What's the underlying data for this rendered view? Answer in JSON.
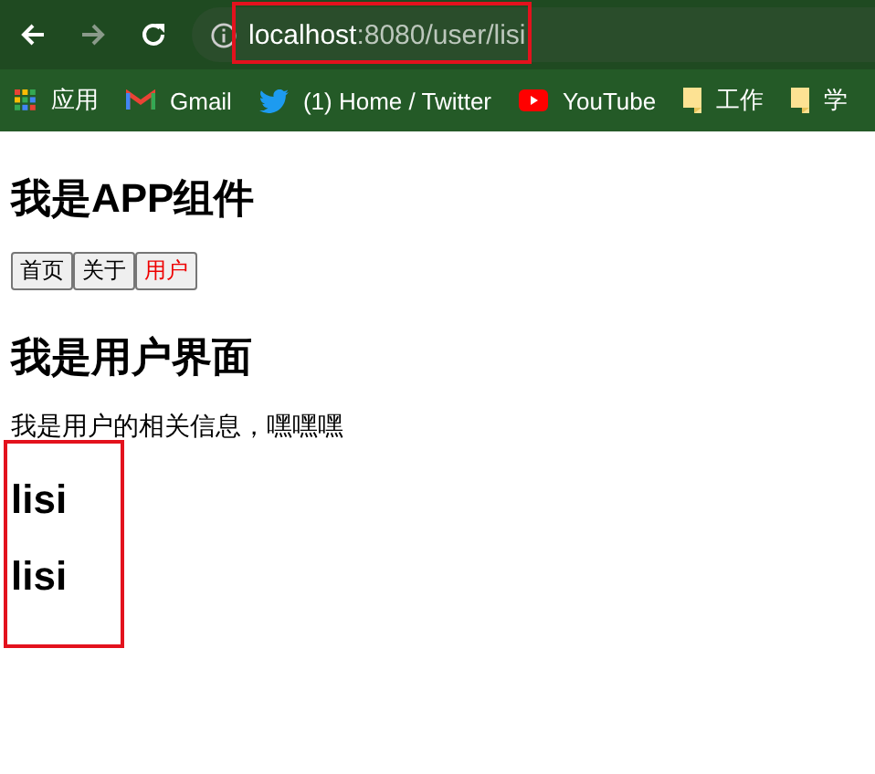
{
  "browser": {
    "url_host": "localhost",
    "url_path": ":8080/user/lisi",
    "bookmarks": [
      {
        "kind": "apps",
        "label": "应用"
      },
      {
        "kind": "gmail",
        "label": "Gmail"
      },
      {
        "kind": "twitter",
        "label": "(1) Home / Twitter"
      },
      {
        "kind": "youtube",
        "label": "YouTube"
      },
      {
        "kind": "folder",
        "label": "工作"
      },
      {
        "kind": "folder",
        "label": "学"
      }
    ]
  },
  "page": {
    "title": "我是APP组件",
    "nav": [
      {
        "label": "首页",
        "selected": false
      },
      {
        "label": "关于",
        "selected": false
      },
      {
        "label": "用户",
        "selected": true
      }
    ],
    "section_title": "我是用户界面",
    "info": "我是用户的相关信息，嘿嘿嘿",
    "names": [
      "lisi",
      "lisi"
    ]
  }
}
